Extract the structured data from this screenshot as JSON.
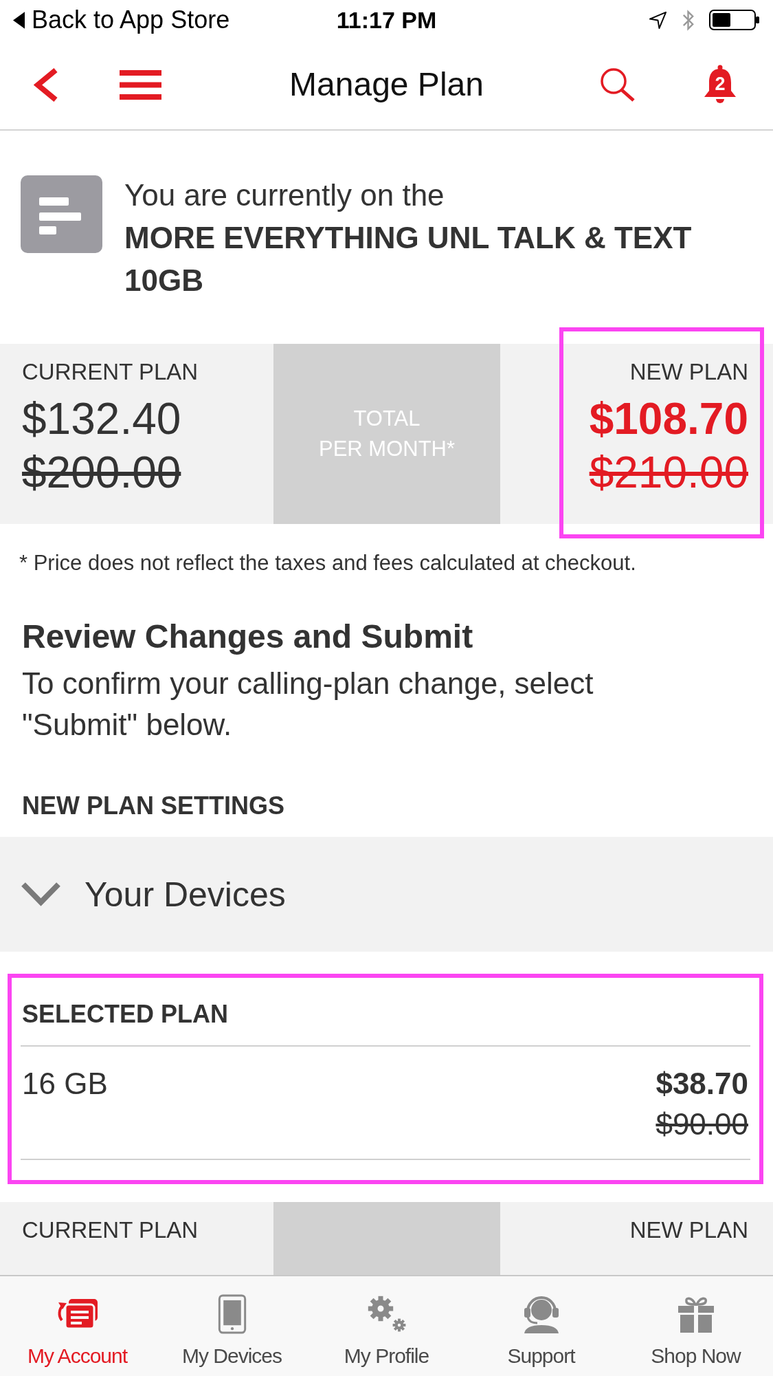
{
  "status_bar": {
    "back_label": "Back to App Store",
    "time": "11:17 PM"
  },
  "nav": {
    "title": "Manage Plan",
    "notification_count": "2"
  },
  "current_plan_banner": {
    "intro": "You are currently on the",
    "plan_name": "MORE EVERYTHING UNL TALK & TEXT 10GB"
  },
  "price_summary": {
    "current_plan": {
      "label": "CURRENT PLAN",
      "price": "$132.40",
      "original_price": "$200.00"
    },
    "middle_label": [
      "TOTAL",
      "PER MONTH*"
    ],
    "new_plan": {
      "label": "NEW PLAN",
      "price": "$108.70",
      "original_price": "$210.00",
      "highlighted": true
    }
  },
  "footnote": "* Price does not reflect the taxes and fees calculated at checkout.",
  "review": {
    "title": "Review Changes and Submit",
    "body": "To confirm your calling-plan change, select \"Submit\" below."
  },
  "settings_heading": "NEW PLAN SETTINGS",
  "devices_accordion": {
    "label": "Your Devices",
    "expanded": false
  },
  "selected_plan": {
    "heading": "SELECTED PLAN",
    "name": "16 GB",
    "price": "$38.70",
    "original_price": "$90.00",
    "highlighted": true
  },
  "bottom_price_summary": {
    "current_label": "CURRENT PLAN",
    "new_label": "NEW PLAN"
  },
  "tabs": [
    {
      "label": "My Account",
      "kind": "account",
      "selected": true
    },
    {
      "label": "My Devices",
      "kind": "devices",
      "selected": false
    },
    {
      "label": "My Profile",
      "kind": "profile",
      "selected": false
    },
    {
      "label": "Support",
      "kind": "support",
      "selected": false
    },
    {
      "label": "Shop Now",
      "kind": "shop",
      "selected": false
    }
  ]
}
